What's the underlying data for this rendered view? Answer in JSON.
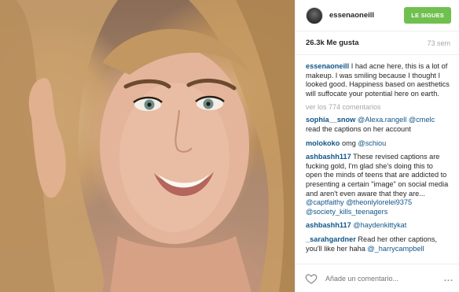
{
  "post": {
    "username": "essenaoneill",
    "follow_label": "LE SIGUES",
    "likes": "26.3k Me gusta",
    "age": "73 sem"
  },
  "comments": {
    "caption_user": "essenaoneill",
    "caption_text": "I had acne here, this is a lot of makeup. I was smiling because I thought I looked good. Happiness based on aesthetics will suffocate your potential here on earth.",
    "view_more": "ver los 774 comentarios",
    "items": [
      {
        "user": "sophia__snow",
        "text": "read the captions on her account",
        "mention": "@Alexa.rangell @cmelc"
      },
      {
        "user": "molokoko",
        "text": "omg",
        "mention": "@schiou"
      },
      {
        "user": "ashbashh117",
        "text": "These revised captions are fucking gold, I'm glad she's doing this to open the minds of teens that are addicted to presenting a certain \"image\" on social media and aren't even aware that they are...",
        "mention": "@captfaithy @theonlylorelei9375 @society_kills_teenagers"
      },
      {
        "user": "ashbashh117",
        "text": "",
        "mention": "@haydenkittykat"
      },
      {
        "user": "_sarahgardner",
        "text": "Read her other captions, you'll like her haha",
        "mention": "@_harrycampbell"
      },
      {
        "user": "",
        "text": "",
        "mention": ""
      }
    ]
  },
  "footer": {
    "comment_placeholder": "Añade un comentario...",
    "more_icon": "..."
  },
  "colors": {
    "follow": "#70c050",
    "link": "#125688",
    "muted": "#a5a7aa"
  }
}
